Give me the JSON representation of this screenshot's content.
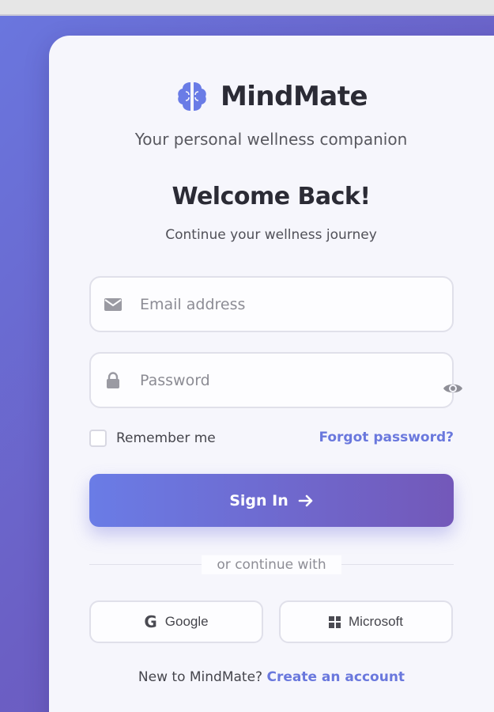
{
  "app": {
    "name": "MindMate",
    "tagline": "Your personal wellness companion",
    "logo_icon": "brain-icon"
  },
  "login": {
    "title": "Welcome Back!",
    "subtitle": "Continue your wellness journey",
    "email": {
      "placeholder": "Email address",
      "icon": "envelope-icon"
    },
    "password": {
      "placeholder": "Password",
      "icon": "lock-icon",
      "toggle_icon": "eye-icon"
    },
    "remember_label": "Remember me",
    "forgot_label": "Forgot password?",
    "submit_label": "Sign In",
    "submit_icon": "arrow-right-icon",
    "divider_text": "or continue with",
    "social": [
      {
        "label": "Google",
        "icon": "google-icon"
      },
      {
        "label": "Microsoft",
        "icon": "microsoft-icon"
      }
    ],
    "footer_text": "New to MindMate?",
    "footer_link": "Create an account"
  },
  "colors": {
    "accent": "#6a78dd",
    "gradient_start": "#6a7ce6",
    "gradient_end": "#7358b9",
    "text_dark": "#2b2b35"
  }
}
